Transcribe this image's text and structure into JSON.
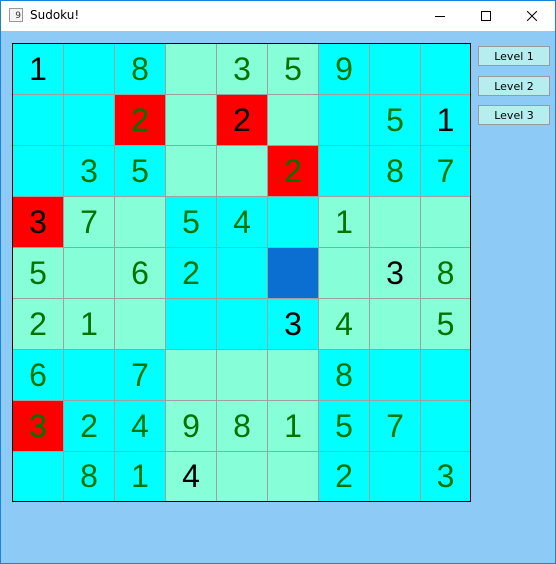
{
  "window": {
    "title": "Sudoku!",
    "icon_glyph": "9",
    "controls": [
      "minimize-icon",
      "maximize-icon",
      "close-icon"
    ]
  },
  "colors": {
    "cyan": "#00ffff",
    "mint": "#86ffd8",
    "red": "#ff0000",
    "selected": "#0a6fd1",
    "given": "#000000",
    "entered": "#007300",
    "window_bg": "#8dcbf6"
  },
  "levels": [
    "Level 1",
    "Level 2",
    "Level 3"
  ],
  "grid": [
    [
      "1",
      "",
      "8",
      "",
      "3",
      "5",
      "9",
      "",
      ""
    ],
    [
      "",
      "",
      "2",
      "",
      "2",
      "",
      "",
      "5",
      "1"
    ],
    [
      "",
      "3",
      "5",
      "",
      "",
      "2",
      "",
      "8",
      "7"
    ],
    [
      "3",
      "7",
      "",
      "5",
      "4",
      "",
      "1",
      "",
      ""
    ],
    [
      "5",
      "",
      "6",
      "2",
      "",
      "",
      "",
      "3",
      "8"
    ],
    [
      "2",
      "1",
      "",
      "",
      "",
      "3",
      "4",
      "",
      "5"
    ],
    [
      "6",
      "",
      "7",
      "",
      "",
      "",
      "8",
      "",
      ""
    ],
    [
      "3",
      "2",
      "4",
      "9",
      "8",
      "1",
      "5",
      "7",
      ""
    ],
    [
      "",
      "8",
      "1",
      "4",
      "",
      "",
      "2",
      "",
      "3"
    ]
  ],
  "backgrounds": [
    [
      "c",
      "c",
      "c",
      "m",
      "m",
      "m",
      "c",
      "c",
      "c"
    ],
    [
      "c",
      "c",
      "r",
      "m",
      "r",
      "m",
      "c",
      "c",
      "c"
    ],
    [
      "c",
      "c",
      "c",
      "m",
      "m",
      "r",
      "c",
      "c",
      "c"
    ],
    [
      "r",
      "m",
      "m",
      "c",
      "c",
      "c",
      "m",
      "m",
      "m"
    ],
    [
      "m",
      "m",
      "m",
      "c",
      "c",
      "s",
      "m",
      "m",
      "m"
    ],
    [
      "m",
      "m",
      "m",
      "c",
      "c",
      "c",
      "m",
      "m",
      "m"
    ],
    [
      "c",
      "c",
      "c",
      "m",
      "m",
      "m",
      "c",
      "c",
      "c"
    ],
    [
      "r",
      "c",
      "c",
      "m",
      "m",
      "m",
      "c",
      "c",
      "c"
    ],
    [
      "c",
      "c",
      "c",
      "m",
      "m",
      "m",
      "c",
      "c",
      "c"
    ]
  ],
  "digit_kind": [
    [
      "g",
      "",
      "e",
      "",
      "e",
      "e",
      "e",
      "",
      ""
    ],
    [
      "",
      "",
      "e",
      "",
      "g",
      "",
      "",
      "e",
      "g"
    ],
    [
      "",
      "e",
      "e",
      "",
      "",
      "e",
      "",
      "e",
      "e"
    ],
    [
      "g",
      "e",
      "",
      "e",
      "e",
      "",
      "e",
      "",
      ""
    ],
    [
      "e",
      "",
      "e",
      "e",
      "",
      "",
      "",
      "g",
      "e"
    ],
    [
      "e",
      "e",
      "",
      "",
      "",
      "g",
      "e",
      "",
      "e"
    ],
    [
      "e",
      "",
      "e",
      "",
      "",
      "",
      "e",
      "",
      ""
    ],
    [
      "e",
      "e",
      "e",
      "e",
      "e",
      "e",
      "e",
      "e",
      ""
    ],
    [
      "",
      "e",
      "e",
      "g",
      "",
      "",
      "e",
      "",
      "e"
    ]
  ]
}
